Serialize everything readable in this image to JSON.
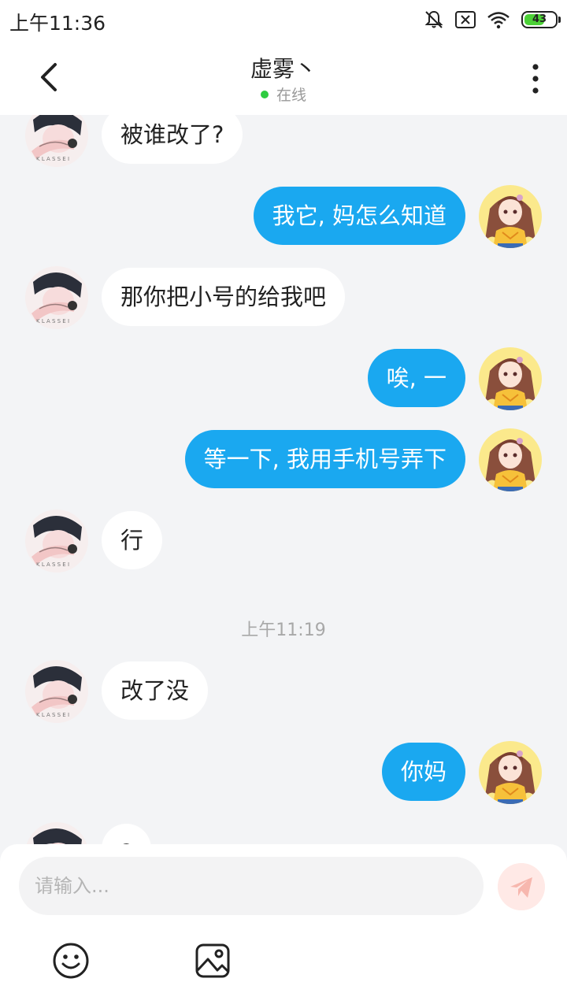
{
  "status_bar": {
    "time": "上午11:36",
    "battery": "43",
    "icons": [
      "mute-icon",
      "no-sim-icon",
      "wifi-icon",
      "battery-icon"
    ]
  },
  "header": {
    "contact_name": "虚雾丶",
    "presence": "在线",
    "icons": [
      "back-arrow-icon",
      "more-vertical-icon"
    ]
  },
  "messages": [
    {
      "from": "them",
      "text": "被谁改了?"
    },
    {
      "from": "me",
      "text": "我它, 妈怎么知道"
    },
    {
      "from": "them",
      "text": "那你把小号的给我吧"
    },
    {
      "from": "me",
      "text": "唉, 一"
    },
    {
      "from": "me",
      "text": "等一下, 我用手机号弄下"
    },
    {
      "from": "them",
      "text": "行"
    },
    {
      "type": "timestamp",
      "text": "上午11:19"
    },
    {
      "from": "them",
      "text": "改了没"
    },
    {
      "from": "me",
      "text": "你妈"
    },
    {
      "from": "them",
      "text": "?"
    }
  ],
  "composer": {
    "placeholder": "请输入...",
    "send_icon": "send-icon",
    "emoji_icon": "emoji-icon",
    "image_icon": "image-icon"
  },
  "colors": {
    "outgoing_bubble": "#1aa8f0",
    "incoming_bubble": "#ffffff",
    "background": "#f3f4f6",
    "online_dot": "#2ecc40",
    "send_button": "#ffe9e6"
  }
}
